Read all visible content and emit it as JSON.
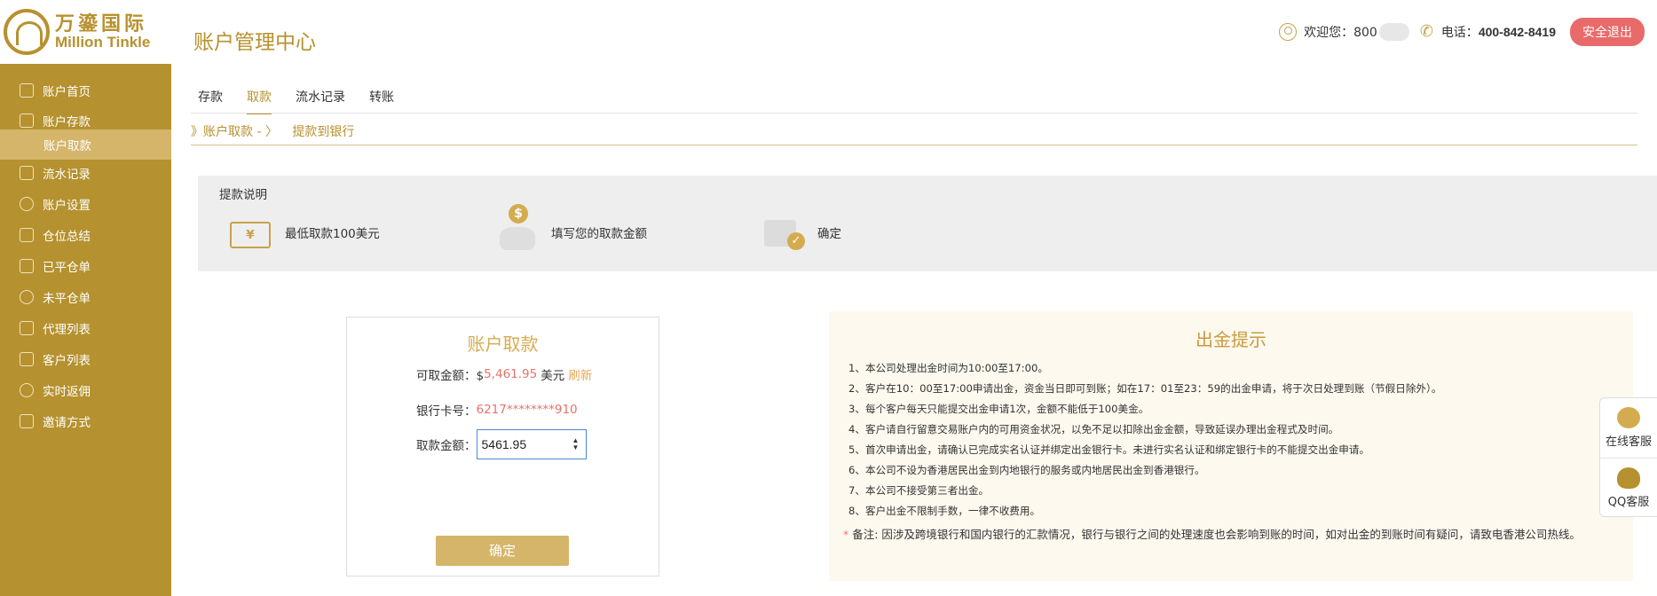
{
  "brand": {
    "cn": "万鎏国际",
    "en": "Million Tinkle"
  },
  "header": {
    "title": "账户管理中心",
    "welcome_label": "欢迎您：800",
    "phone_label": "电话：",
    "phone_number": "400-842-8419",
    "logout_label": "安全退出"
  },
  "sidebar": {
    "items": [
      {
        "label": "账户首页",
        "icon": "home-icon"
      },
      {
        "label": "账户存款",
        "icon": "deposit-icon"
      },
      {
        "label": "账户取款",
        "icon": "",
        "active": true
      },
      {
        "label": "流水记录",
        "icon": "record-icon"
      },
      {
        "label": "账户设置",
        "icon": "gear-icon"
      },
      {
        "label": "仓位总结",
        "icon": "summary-icon"
      },
      {
        "label": "已平仓单",
        "icon": "closed-orders-icon"
      },
      {
        "label": "未平仓单",
        "icon": "open-orders-icon"
      },
      {
        "label": "代理列表",
        "icon": "agent-list-icon"
      },
      {
        "label": "客户列表",
        "icon": "client-list-icon"
      },
      {
        "label": "实时返佣",
        "icon": "rebate-icon"
      },
      {
        "label": "邀请方式",
        "icon": "invite-icon"
      }
    ]
  },
  "tabs": [
    {
      "label": "存款"
    },
    {
      "label": "取款",
      "active": true
    },
    {
      "label": "流水记录"
    },
    {
      "label": "转账"
    }
  ],
  "breadcrumb": {
    "parent": "》账户取款 - 〉",
    "current": "提款到银行"
  },
  "instructions": {
    "title": "提款说明",
    "steps": [
      {
        "label": "最低取款100美元",
        "icon": "wallet-icon"
      },
      {
        "label": "填写您的取款金额",
        "icon": "money-bag-icon"
      },
      {
        "label": "确定",
        "icon": "confirm-check-icon"
      }
    ]
  },
  "withdraw_form": {
    "title": "账户取款",
    "available_label": "可取金额：$",
    "available_value": "5,461.95",
    "currency": "美元",
    "refresh_label": "刷新",
    "card_label": "银行卡号：",
    "card_value": "6217********910",
    "amount_label": "取款金额：",
    "amount_value": "5461.95",
    "submit_label": "确定"
  },
  "tips": {
    "title": "出金提示",
    "items": [
      "1、本公司处理出金时间为10:00至17:00。",
      "2、客户在10：00至17:00申请出金，资金当日即可到账；如在17：01至23：59的出金申请，将于次日处理到账（节假日除外）。",
      "3、每个客户每天只能提交出金申请1次，金额不能低于100美金。",
      "4、客户请自行留意交易账户内的可用资金状况，以免不足以扣除出金金额，导致延误办理出金程式及时间。",
      "5、首次申请出金，请确认已完成实名认证并绑定出金银行卡。未进行实名认证和绑定银行卡的不能提交出金申请。",
      "6、本公司不设为香港居民出金到内地银行的服务或内地居民出金到香港银行。",
      "7、本公司不接受第三者出金。",
      "8、客户出金不限制手数，一律不收费用。"
    ],
    "note_star": "*",
    "note": " 备注: 因涉及跨境银行和国内银行的汇款情况，银行与银行之间的处理速度也会影响到账的时间，如对出金的到账时间有疑问，请致电香港公司热线。"
  },
  "float_service": {
    "online_label": "在线客服",
    "qq_label": "QQ客服"
  }
}
